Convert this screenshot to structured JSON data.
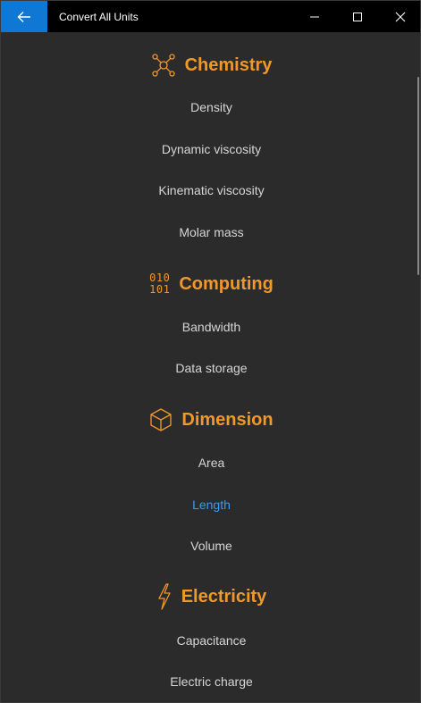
{
  "window": {
    "title": "Convert All Units"
  },
  "colors": {
    "accent": "#f0982a",
    "back_button": "#0f78d4",
    "selected_item": "#3a9bf0"
  },
  "sections": {
    "chemistry": {
      "title": "Chemistry",
      "icon": "molecule-icon",
      "items": [
        "Density",
        "Dynamic viscosity",
        "Kinematic viscosity",
        "Molar mass"
      ]
    },
    "computing": {
      "title": "Computing",
      "icon": "binary-icon",
      "icon_text": [
        "010",
        "101"
      ],
      "items": [
        "Bandwidth",
        "Data storage"
      ]
    },
    "dimension": {
      "title": "Dimension",
      "icon": "cube-icon",
      "items": [
        "Area",
        "Length",
        "Volume"
      ],
      "selected": "Length"
    },
    "electricity": {
      "title": "Electricity",
      "icon": "lightning-icon",
      "items": [
        "Capacitance",
        "Electric charge"
      ]
    }
  }
}
